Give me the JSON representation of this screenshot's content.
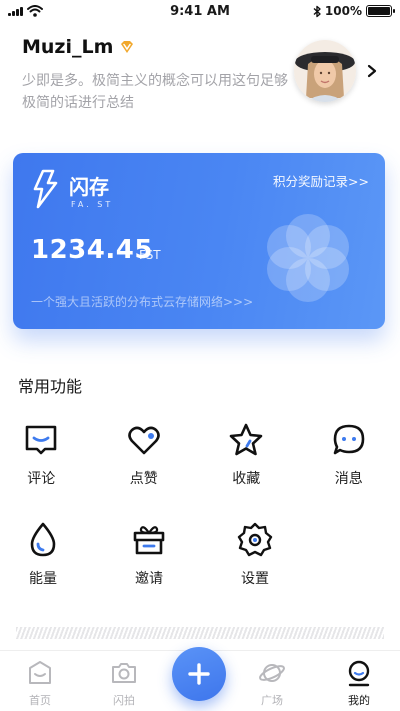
{
  "status_bar": {
    "time": "9:41 AM",
    "battery_text": "100%",
    "battery_level": 1.0
  },
  "profile": {
    "username": "Muzi_Lm",
    "bio": "少即是多。极简主义的概念可以用这句足够极简的话进行总结"
  },
  "card": {
    "logo_text": "闪存",
    "logo_subtext": "FA. ST",
    "rewards_link": "积分奖励记录>>",
    "amount": "1234.45",
    "unit": "FST",
    "tagline": "一个强大且活跃的分布式云存储网络>>>"
  },
  "features": {
    "title": "常用功能",
    "items": [
      {
        "label": "评论",
        "icon": "comment-icon"
      },
      {
        "label": "点赞",
        "icon": "heart-icon"
      },
      {
        "label": "收藏",
        "icon": "star-icon"
      },
      {
        "label": "消息",
        "icon": "message-icon"
      },
      {
        "label": "能量",
        "icon": "drop-icon"
      },
      {
        "label": "邀请",
        "icon": "gift-icon"
      },
      {
        "label": "设置",
        "icon": "gear-icon"
      }
    ]
  },
  "tab_bar": {
    "tabs": [
      {
        "label": "首页",
        "icon": "home-icon"
      },
      {
        "label": "闪拍",
        "icon": "camera-icon"
      },
      {
        "label": "广场",
        "icon": "planet-icon"
      },
      {
        "label": "我的",
        "icon": "profile-icon",
        "active": true
      }
    ],
    "center_action": "plus-icon"
  },
  "colors": {
    "accent": "#3e7bee",
    "card_gradient_start": "#3f78ee",
    "card_gradient_end": "#5b97f6",
    "muted_text": "#a3a3a8",
    "vip_gold": "#f1a82c"
  }
}
